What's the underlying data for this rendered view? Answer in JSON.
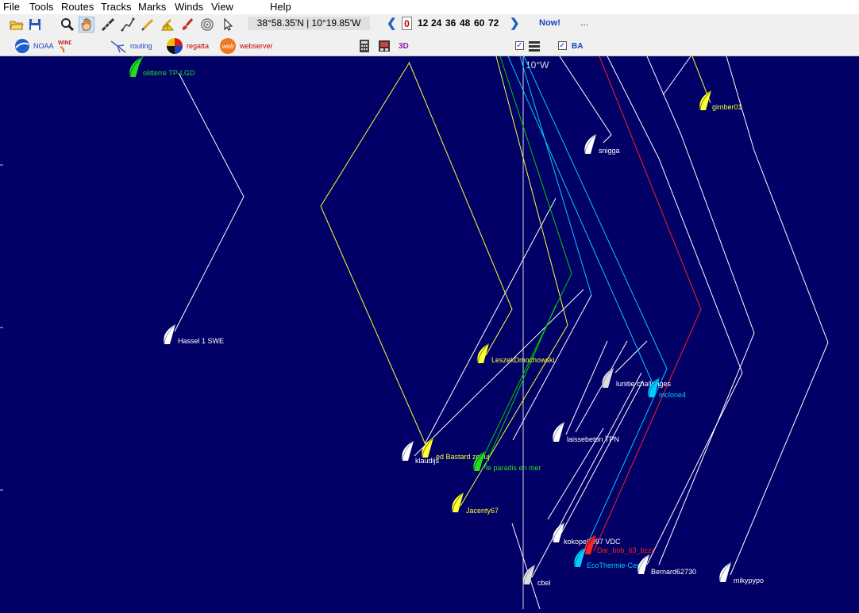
{
  "menu": {
    "items": [
      "File",
      "Tools",
      "Routes",
      "Tracks",
      "Marks",
      "Winds",
      "View",
      "Help"
    ]
  },
  "toolbar": {
    "icons": [
      "open-folder-icon",
      "save-icon",
      "zoom-icon",
      "hand-icon",
      "ruler-icon",
      "route-icon",
      "pencil-icon",
      "erase-warning-icon",
      "paint-brush-icon",
      "target-icon",
      "pointer-icon"
    ],
    "coordinates": "38°58.35'N | 10°19.85'W",
    "time_steps": [
      "0",
      "12",
      "24",
      "36",
      "48",
      "60",
      "72"
    ],
    "selected_step": "0",
    "now_label": "Now!",
    "more_label": "..."
  },
  "toolbar2": {
    "noaa_label": "NOAA",
    "routing_label": "routing",
    "regatta_label": "regatta",
    "webserver_label": "webserver",
    "view3d_label": "3D",
    "ba_label": "BA"
  },
  "map": {
    "meridian_label": "10°W",
    "colors": {
      "sea": "#000066",
      "white": "#ffffff",
      "yellow": "#ffff33",
      "green": "#00cc00",
      "cyan": "#00ccff",
      "red": "#ff2020"
    },
    "boats": [
      {
        "name": "olitterre TP-LGD",
        "color": "#22dd22"
      },
      {
        "name": "gimber01",
        "color": "#ffff33"
      },
      {
        "name": "snigga",
        "color": "#ffffff"
      },
      {
        "name": "Hassel 1 SWE",
        "color": "#ffffff"
      },
      {
        "name": "LeszekDmochowski",
        "color": "#ffff33"
      },
      {
        "name": "lunitie challenges",
        "color": "#ffffff"
      },
      {
        "name": "mclone4",
        "color": "#00ccff"
      },
      {
        "name": "laissebeton TPN",
        "color": "#ffffff"
      },
      {
        "name": "klaudijs",
        "color": "#ffffff"
      },
      {
        "name": "ed Bastard zeouj",
        "color": "#ffff33"
      },
      {
        "name": "le paradis en mer",
        "color": "#22dd22"
      },
      {
        "name": "Jacenty67",
        "color": "#ffff33"
      },
      {
        "name": "kokopelli097 VDC",
        "color": "#ffffff"
      },
      {
        "name": "Dar_bob_63_bzzz",
        "color": "#ff2020"
      },
      {
        "name": "EcoThermie-Centr",
        "color": "#00ccff"
      },
      {
        "name": "Bernard62730",
        "color": "#ffffff"
      },
      {
        "name": "mikypypo",
        "color": "#ffffff"
      },
      {
        "name": "cbel",
        "color": "#ffffff"
      }
    ]
  }
}
